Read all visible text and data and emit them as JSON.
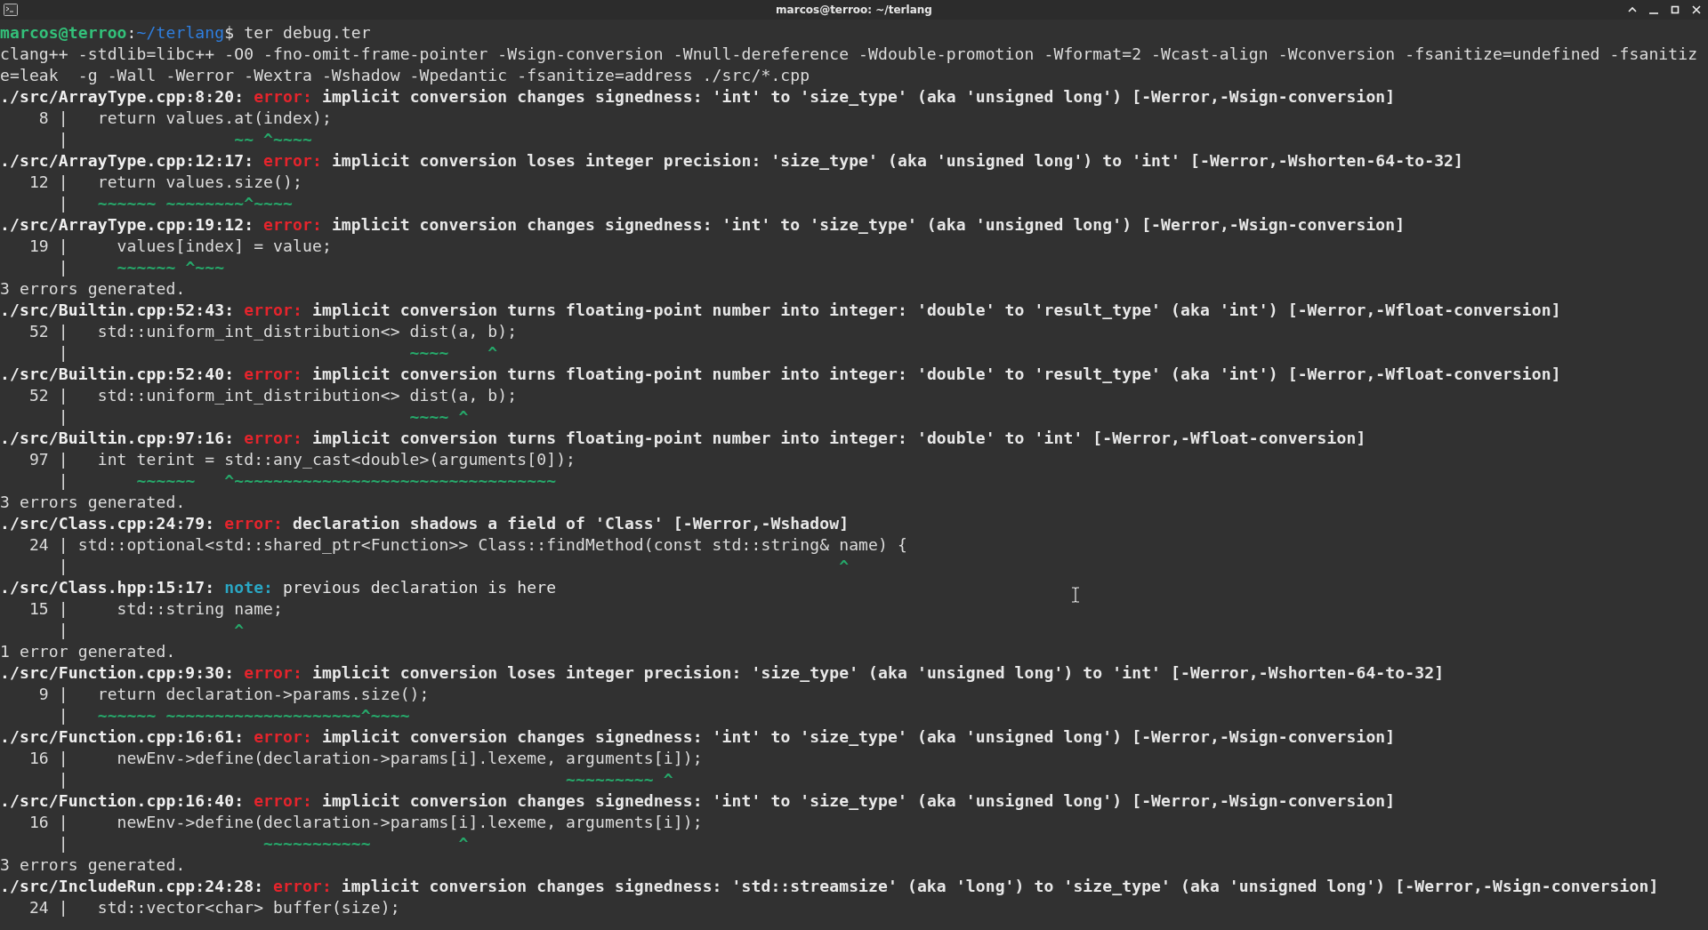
{
  "window": {
    "title": "marcos@terroo: ~/terlang"
  },
  "terminal": {
    "lines": [
      {
        "kind": "prompt",
        "user_host": "marcos@terroo",
        "separator": ":",
        "path": "~/terlang",
        "command": "$ ter debug.ter"
      },
      {
        "kind": "text",
        "text": "clang++ -stdlib=libc++ -O0 -fno-omit-frame-pointer -Wsign-conversion -Wnull-dereference -Wdouble-promotion -Wformat=2 -Wcast-align -Wconversion -fsanitize=undefined -fsanitiz"
      },
      {
        "kind": "text",
        "text": "e=leak  -g -Wall -Werror -Wextra -Wshadow -Wpedantic -fsanitize=address ./src/*.cpp"
      },
      {
        "kind": "error",
        "location": "./src/ArrayType.cpp:8:20:",
        "label": "error:",
        "message": "implicit conversion changes signedness: 'int' to 'size_type' (aka 'unsigned long') [-Werror,-Wsign-conversion]"
      },
      {
        "kind": "code",
        "gutter": "    8 |",
        "text": "   return values.at(index);"
      },
      {
        "kind": "marker",
        "gutter": "      |",
        "text": "                 ~~ ^~~~~"
      },
      {
        "kind": "error",
        "location": "./src/ArrayType.cpp:12:17:",
        "label": "error:",
        "message": "implicit conversion loses integer precision: 'size_type' (aka 'unsigned long') to 'int' [-Werror,-Wshorten-64-to-32]"
      },
      {
        "kind": "code",
        "gutter": "   12 |",
        "text": "   return values.size();"
      },
      {
        "kind": "marker",
        "gutter": "      |",
        "text": "   ~~~~~~ ~~~~~~~~^~~~~"
      },
      {
        "kind": "error",
        "location": "./src/ArrayType.cpp:19:12:",
        "label": "error:",
        "message": "implicit conversion changes signedness: 'int' to 'size_type' (aka 'unsigned long') [-Werror,-Wsign-conversion]"
      },
      {
        "kind": "code",
        "gutter": "   19 |",
        "text": "     values[index] = value;"
      },
      {
        "kind": "marker",
        "gutter": "      |",
        "text": "     ~~~~~~ ^~~~"
      },
      {
        "kind": "text",
        "text": "3 errors generated."
      },
      {
        "kind": "error",
        "location": "./src/Builtin.cpp:52:43:",
        "label": "error:",
        "message": "implicit conversion turns floating-point number into integer: 'double' to 'result_type' (aka 'int') [-Werror,-Wfloat-conversion]"
      },
      {
        "kind": "code",
        "gutter": "   52 |",
        "text": "   std::uniform_int_distribution<> dist(a, b);"
      },
      {
        "kind": "marker",
        "gutter": "      |",
        "text": "                                   ~~~~    ^"
      },
      {
        "kind": "error",
        "location": "./src/Builtin.cpp:52:40:",
        "label": "error:",
        "message": "implicit conversion turns floating-point number into integer: 'double' to 'result_type' (aka 'int') [-Werror,-Wfloat-conversion]"
      },
      {
        "kind": "code",
        "gutter": "   52 |",
        "text": "   std::uniform_int_distribution<> dist(a, b);"
      },
      {
        "kind": "marker",
        "gutter": "      |",
        "text": "                                   ~~~~ ^"
      },
      {
        "kind": "error",
        "location": "./src/Builtin.cpp:97:16:",
        "label": "error:",
        "message": "implicit conversion turns floating-point number into integer: 'double' to 'int' [-Werror,-Wfloat-conversion]"
      },
      {
        "kind": "code",
        "gutter": "   97 |",
        "text": "   int terint = std::any_cast<double>(arguments[0]);"
      },
      {
        "kind": "marker",
        "gutter": "      |",
        "text": "       ~~~~~~   ^~~~~~~~~~~~~~~~~~~~~~~~~~~~~~~~~~"
      },
      {
        "kind": "text",
        "text": "3 errors generated."
      },
      {
        "kind": "error",
        "location": "./src/Class.cpp:24:79:",
        "label": "error:",
        "message": "declaration shadows a field of 'Class' [-Werror,-Wshadow]"
      },
      {
        "kind": "code",
        "gutter": "   24 |",
        "text": " std::optional<std::shared_ptr<Function>> Class::findMethod(const std::string& name) {"
      },
      {
        "kind": "marker",
        "gutter": "      |",
        "text": "                                                                               ^"
      },
      {
        "kind": "note",
        "location": "./src/Class.hpp:15:17:",
        "label": "note:",
        "message": "previous declaration is here"
      },
      {
        "kind": "code",
        "gutter": "   15 |",
        "text": "     std::string name;"
      },
      {
        "kind": "marker",
        "gutter": "      |",
        "text": "                 ^"
      },
      {
        "kind": "text",
        "text": "1 error generated."
      },
      {
        "kind": "error",
        "location": "./src/Function.cpp:9:30:",
        "label": "error:",
        "message": "implicit conversion loses integer precision: 'size_type' (aka 'unsigned long') to 'int' [-Werror,-Wshorten-64-to-32]"
      },
      {
        "kind": "code",
        "gutter": "    9 |",
        "text": "   return declaration->params.size();"
      },
      {
        "kind": "marker",
        "gutter": "      |",
        "text": "   ~~~~~~ ~~~~~~~~~~~~~~~~~~~~^~~~~"
      },
      {
        "kind": "error",
        "location": "./src/Function.cpp:16:61:",
        "label": "error:",
        "message": "implicit conversion changes signedness: 'int' to 'size_type' (aka 'unsigned long') [-Werror,-Wsign-conversion]"
      },
      {
        "kind": "code",
        "gutter": "   16 |",
        "text": "     newEnv->define(declaration->params[i].lexeme, arguments[i]);"
      },
      {
        "kind": "marker",
        "gutter": "      |",
        "text": "                                                   ~~~~~~~~~ ^"
      },
      {
        "kind": "error",
        "location": "./src/Function.cpp:16:40:",
        "label": "error:",
        "message": "implicit conversion changes signedness: 'int' to 'size_type' (aka 'unsigned long') [-Werror,-Wsign-conversion]"
      },
      {
        "kind": "code",
        "gutter": "   16 |",
        "text": "     newEnv->define(declaration->params[i].lexeme, arguments[i]);"
      },
      {
        "kind": "marker",
        "gutter": "      |",
        "text": "                    ~~~~~~~~~~~         ^"
      },
      {
        "kind": "text",
        "text": "3 errors generated."
      },
      {
        "kind": "error",
        "location": "./src/IncludeRun.cpp:24:28:",
        "label": "error:",
        "message": "implicit conversion changes signedness: 'std::streamsize' (aka 'long') to 'size_type' (aka 'unsigned long') [-Werror,-Wsign-conversion]"
      },
      {
        "kind": "code",
        "gutter": "   24 |",
        "text": "   std::vector<char> buffer(size);"
      }
    ]
  }
}
